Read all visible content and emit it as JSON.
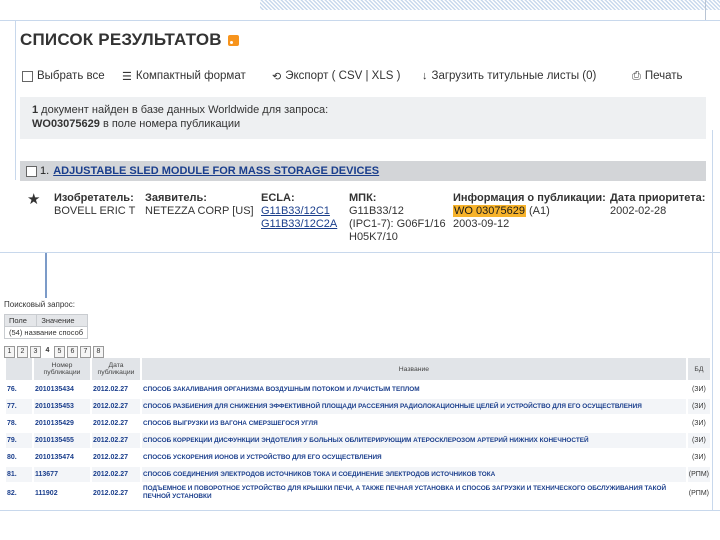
{
  "header": {
    "title": "СПИСОК РЕЗУЛЬТАТОВ"
  },
  "toolbar": {
    "select_all": "Выбрать все",
    "compact": "Компактный формат",
    "export": "Экспорт ( CSV | XLS )",
    "download": "Загрузить титульные листы (0)",
    "print": "Печать"
  },
  "info": {
    "line1_count": "1",
    "line1_text": " документ найден в базе данных Worldwide для запроса:",
    "line2_code": "WO03075629",
    "line2_text": " в поле номера публикации"
  },
  "result": {
    "index": "1.",
    "title": "ADJUSTABLE SLED MODULE FOR MASS STORAGE DEVICES",
    "inventor_label": "Изобретатель:",
    "inventor": "BOVELL ERIC T",
    "applicant_label": "Заявитель:",
    "applicant": "NETEZZA CORP [US]",
    "ecla_label": "ECLA:",
    "ecla1": "G11B33/12C1",
    "ecla2": "G11B33/12C2A",
    "ipc_label": "МПК:",
    "ipc1": "G11B33/12",
    "ipc2": "(IPC1-7): G06F1/16",
    "ipc3": "H05K7/10",
    "pubinfo_label": "Информация о публикации:",
    "pub_number": "WO 03075629",
    "pub_kind": " (A1)",
    "pub_date": "2003-09-12",
    "priority_label": "Дата приоритета:",
    "priority_date": "2002-02-28"
  },
  "lower": {
    "query_label": "Поисковый запрос:",
    "mini_headers": [
      "Поле",
      "Значение"
    ],
    "mini_row": "(54) название способ",
    "pages": [
      "1",
      "2",
      "3",
      "4",
      "5",
      "6",
      "7",
      "8"
    ],
    "current_page": "4",
    "columns": [
      "",
      "Номер публикации",
      "Дата публикации",
      "Название",
      "БД"
    ],
    "rows": [
      {
        "idx": "76.",
        "num": "2010135434",
        "date": "2012.02.27",
        "title": "СПОСОБ ЗАКАЛИВАНИЯ ОРГАНИЗМА ВОЗДУШНЫМ ПОТОКОМ И ЛУЧИСТЫМ ТЕПЛОМ",
        "db": "(ЗИ)"
      },
      {
        "idx": "77.",
        "num": "2010135453",
        "date": "2012.02.27",
        "title": "СПОСОБ РАЗБИЕНИЯ ДЛЯ СНИЖЕНИЯ ЭФФЕКТИВНОЙ ПЛОЩАДИ РАССЕЯНИЯ РАДИОЛОКАЦИОННЫЕ ЦЕЛЕЙ И УСТРОЙСТВО ДЛЯ ЕГО ОСУЩЕСТВЛЕНИЯ",
        "db": "(ЗИ)"
      },
      {
        "idx": "78.",
        "num": "2010135429",
        "date": "2012.02.27",
        "title": "СПОСОБ ВЫГРУЗКИ ИЗ ВАГОНА СМЕРЗШЕГОСЯ УГЛЯ",
        "db": "(ЗИ)"
      },
      {
        "idx": "79.",
        "num": "2010135455",
        "date": "2012.02.27",
        "title": "СПОСОБ КОРРЕКЦИИ ДИСФУНКЦИИ ЭНДОТЕЛИЯ У БОЛЬНЫХ ОБЛИТЕРИРУЮЩИМ АТЕРОСКЛЕРОЗОМ АРТЕРИЙ НИЖНИХ КОНЕЧНОСТЕЙ",
        "db": "(ЗИ)"
      },
      {
        "idx": "80.",
        "num": "2010135474",
        "date": "2012.02.27",
        "title": "СПОСОБ УСКОРЕНИЯ ИОНОВ И УСТРОЙСТВО ДЛЯ ЕГО ОСУЩЕСТВЛЕНИЯ",
        "db": "(ЗИ)"
      },
      {
        "idx": "81.",
        "num": "113677",
        "date": "2012.02.27",
        "title": "СПОСОБ СОЕДИНЕНИЯ ЭЛЕКТРОДОВ ИСТОЧНИКОВ ТОКА И СОЕДИНЕНИЕ ЭЛЕКТРОДОВ ИСТОЧНИКОВ ТОКА",
        "db": "(РПМ)"
      },
      {
        "idx": "82.",
        "num": "111902",
        "date": "2012.02.27",
        "title": "ПОДЪЕМНОЕ И ПОВОРОТНОЕ УСТРОЙСТВО ДЛЯ КРЫШКИ ПЕЧИ, А ТАКЖЕ ПЕЧНАЯ УСТАНОВКА И СПОСОБ ЗАГРУЗКИ И ТЕХНИЧЕСКОГО ОБСЛУЖИВАНИЯ ТАКОЙ ПЕЧНОЙ УСТАНОВКИ",
        "db": "(РПМ)"
      }
    ]
  }
}
